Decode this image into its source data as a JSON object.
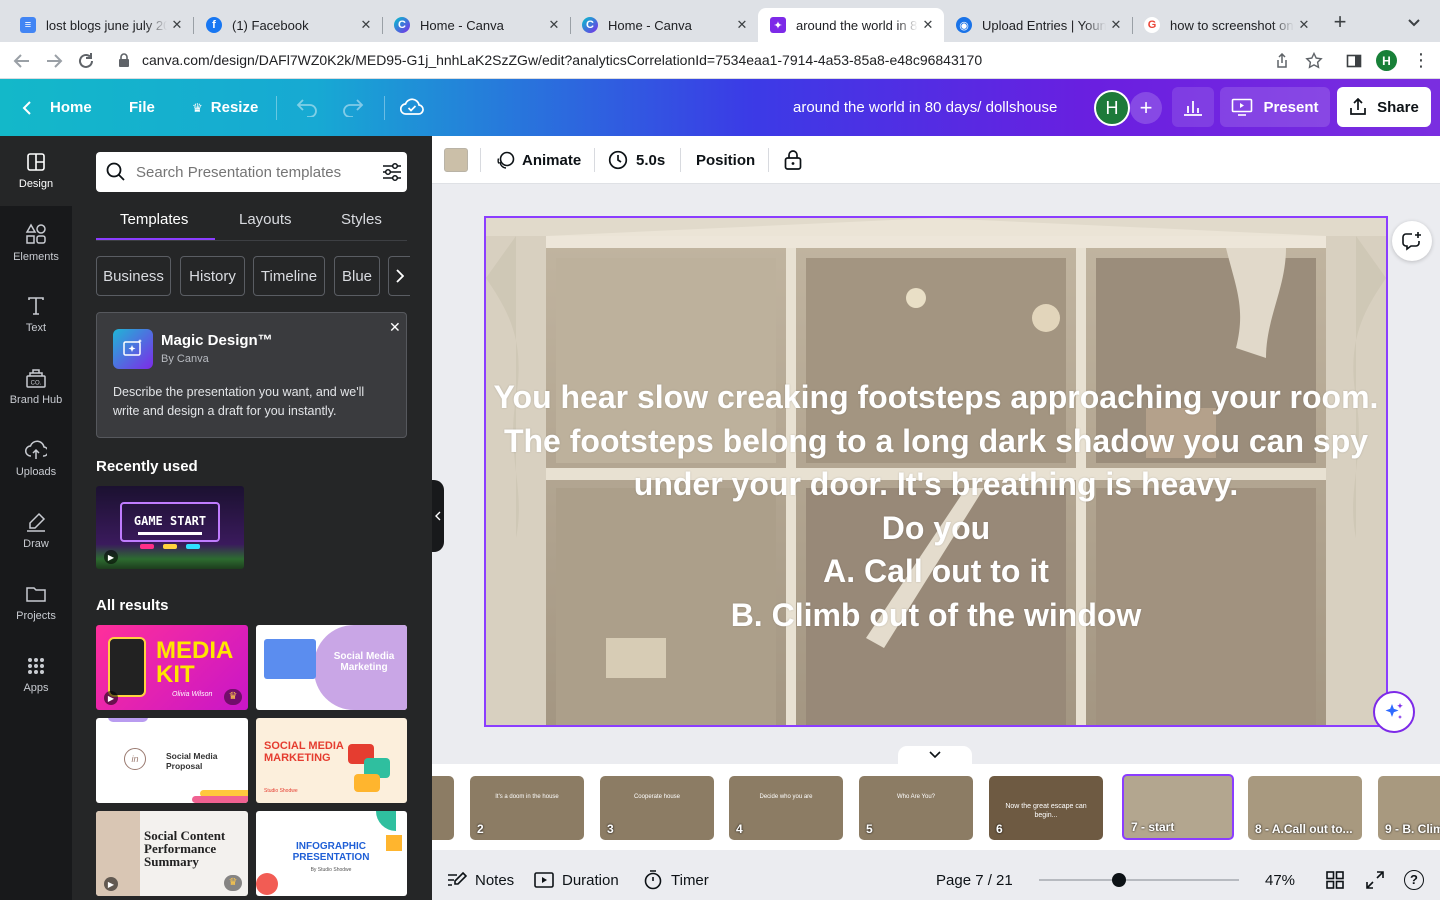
{
  "browser": {
    "tabs": [
      {
        "title": "lost blogs june july 20",
        "icon": "google-docs-icon",
        "color": "#4285f4"
      },
      {
        "title": "(1) Facebook",
        "icon": "facebook-icon",
        "color": "#1877f2"
      },
      {
        "title": "Home - Canva",
        "icon": "canva-icon",
        "color": "#00c4cc"
      },
      {
        "title": "Home - Canva",
        "icon": "canva-icon",
        "color": "#00c4cc"
      },
      {
        "title": "around the world in 80",
        "icon": "canva-design-icon",
        "color": "#7d2ae8"
      },
      {
        "title": "Upload Entries | Youn",
        "icon": "globe-icon",
        "color": "#1a73e8"
      },
      {
        "title": "how to screenshot on",
        "icon": "google-icon",
        "color": "#ea4335"
      }
    ],
    "url": "canva.com/design/DAFl7WZ0K2k/MED95-G1j_hnhLaK2SzZGw/edit?analyticsCorrelationId=7534eaa1-7914-4a53-85a8-e48c96843170",
    "profile_initial": "H"
  },
  "header": {
    "home": "Home",
    "file": "File",
    "resize": "Resize",
    "design_title": "around the world in 80 days/ dollshouse",
    "avatar_initial": "H",
    "present": "Present",
    "share": "Share"
  },
  "rail": [
    {
      "label": "Design",
      "icon": "design-icon"
    },
    {
      "label": "Elements",
      "icon": "elements-icon"
    },
    {
      "label": "Text",
      "icon": "text-icon"
    },
    {
      "label": "Brand Hub",
      "icon": "brand-hub-icon"
    },
    {
      "label": "Uploads",
      "icon": "uploads-icon"
    },
    {
      "label": "Draw",
      "icon": "draw-icon"
    },
    {
      "label": "Projects",
      "icon": "folder-icon"
    },
    {
      "label": "Apps",
      "icon": "apps-icon"
    }
  ],
  "panel": {
    "search_placeholder": "Search Presentation templates",
    "tabs": [
      "Templates",
      "Layouts",
      "Styles"
    ],
    "chips": [
      "Business",
      "History",
      "Timeline",
      "Blue"
    ],
    "magic": {
      "title": "Magic Design™",
      "by": "By Canva",
      "desc": "Describe the presentation you want, and we'll write and design a draft for you instantly."
    },
    "recently_used": "Recently used",
    "recent_thumb_text": "GAME START",
    "all_results": "All results",
    "results": [
      {
        "title": "MEDIA KIT",
        "sub": "Olivia Wilson"
      },
      {
        "title": "Social Media Marketing",
        "sub": ""
      },
      {
        "title": "Social Media Proposal",
        "sub": ""
      },
      {
        "title": "SOCIAL MEDIA MARKETING",
        "sub": "Studio Shodwe"
      },
      {
        "title": "Social Content Performance Summary",
        "sub": ""
      },
      {
        "title": "INFOGRAPHIC PRESENTATION",
        "sub": "By Studio Shodwe"
      }
    ]
  },
  "toolbar": {
    "color": "#cbbfa8",
    "animate": "Animate",
    "duration": "5.0s",
    "position": "Position"
  },
  "slide": {
    "lines": [
      "You hear slow creaking footsteps approaching your room.",
      "The footsteps belong to a long dark shadow you can spy",
      "under your door. It's breathing is heavy.",
      "Do you",
      "A. Call out to it",
      "B. Climb out of the window"
    ]
  },
  "filmstrip": [
    {
      "label": "",
      "text": ""
    },
    {
      "label": "2",
      "text": "It's a doom in the house"
    },
    {
      "label": "3",
      "text": "Cooperate house"
    },
    {
      "label": "4",
      "text": "Decide who you are"
    },
    {
      "label": "5",
      "text": "Who Are You?"
    },
    {
      "label": "6",
      "text": "Now the great escape can begin..."
    },
    {
      "label": "7 - start",
      "text": ""
    },
    {
      "label": "8 - A.Call out to...",
      "text": ""
    },
    {
      "label": "9 - B. Clim",
      "text": ""
    }
  ],
  "footer": {
    "notes": "Notes",
    "duration": "Duration",
    "timer": "Timer",
    "page": "Page 7 / 21",
    "zoom": "47%",
    "zoom_level": 0.4
  }
}
